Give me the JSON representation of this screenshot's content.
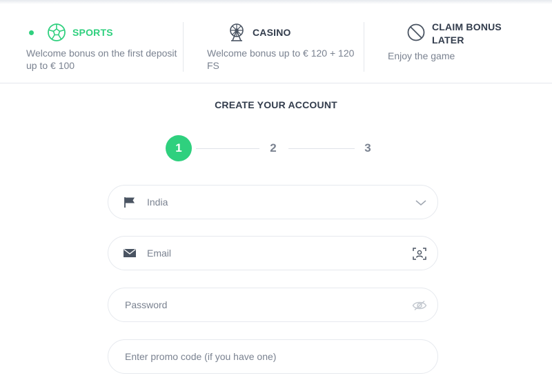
{
  "bonuses": {
    "sports": {
      "title": "SPORTS",
      "description": "Welcome bonus on the first deposit up to € 100",
      "selected": true,
      "icon": "soccer-ball-icon"
    },
    "casino": {
      "title": "CASINO",
      "description": "Welcome bonus up to € 120 + 120 FS",
      "icon": "ferris-wheel-icon"
    },
    "later": {
      "title": "CLAIM BONUS LATER",
      "description": "Enjoy the game",
      "icon": "no-bonus-icon"
    }
  },
  "form": {
    "title": "CREATE YOUR ACCOUNT",
    "steps": [
      "1",
      "2",
      "3"
    ],
    "active_step": 1,
    "country": {
      "value": "India",
      "icon": "flag-icon"
    },
    "email": {
      "placeholder": "Email",
      "icon": "envelope-icon"
    },
    "password": {
      "placeholder": "Password"
    },
    "promo": {
      "placeholder": "Enter promo code (if you have one)"
    }
  },
  "colors": {
    "accent": "#2fd07e",
    "text": "#323c4c",
    "muted": "#7a8290",
    "border": "#e6e9ee"
  }
}
